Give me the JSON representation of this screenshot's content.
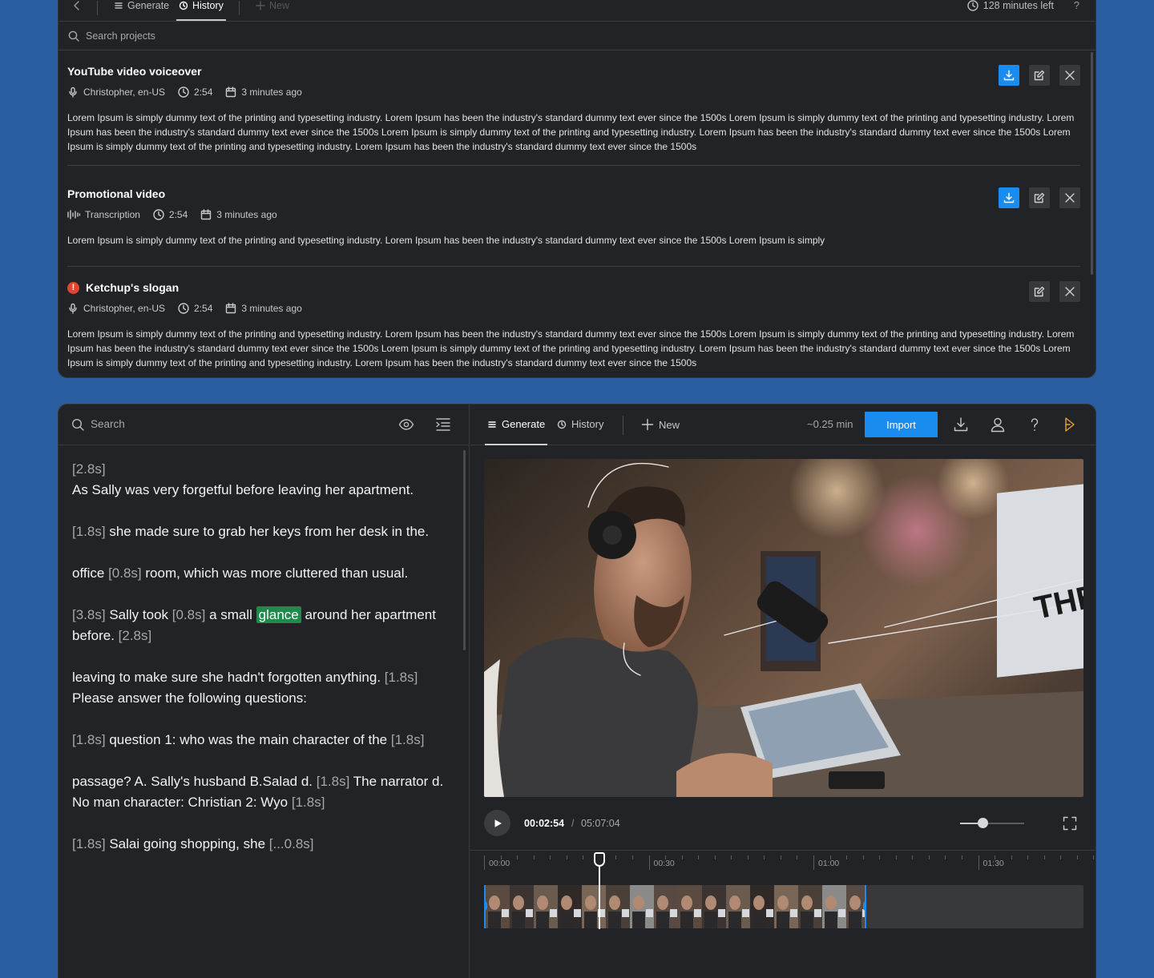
{
  "top_panel": {
    "toolbar": {
      "tabs": [
        {
          "label": "Generate"
        },
        {
          "label": "History"
        },
        {
          "label": "New"
        }
      ],
      "minutes_left": "128 minutes left",
      "help": "?"
    },
    "search": {
      "placeholder": "Search projects"
    },
    "projects": [
      {
        "title": "YouTube video voiceover",
        "voice": "Christopher, en-US",
        "duration": "2:54",
        "date": "3 minutes ago",
        "text": "Lorem Ipsum is simply dummy text of the printing and typesetting industry. Lorem Ipsum has been the industry's standard dummy text ever since the 1500s Lorem Ipsum is simply dummy text of the printing and typesetting industry. Lorem Ipsum has been the industry's standard dummy text ever since the 1500s  Lorem Ipsum is simply dummy text of the printing and typesetting industry. Lorem Ipsum has been the industry's standard dummy text ever since the 1500s Lorem Ipsum is simply dummy text of the printing and typesetting industry. Lorem Ipsum has been the industry's standard dummy text ever since the 1500s"
      },
      {
        "title": "Promotional video",
        "voice": "Transcription",
        "duration": "2:54",
        "date": "3 minutes ago",
        "text": "Lorem Ipsum is simply dummy text of the printing and typesetting industry. Lorem Ipsum has been the industry's standard dummy text ever since the 1500s Lorem Ipsum is simply"
      },
      {
        "title": "Ketchup's slogan",
        "status": "error",
        "voice": "Christopher, en-US",
        "duration": "2:54",
        "date": "3 minutes ago",
        "text": "Lorem Ipsum is simply dummy text of the printing and typesetting industry. Lorem Ipsum has been the industry's standard dummy text ever since the 1500s Lorem Ipsum is simply dummy text of the printing and typesetting industry. Lorem Ipsum has been the industry's standard dummy text ever since the 1500s  Lorem Ipsum is simply dummy text of the printing and typesetting industry. Lorem Ipsum has been the industry's standard dummy text ever since the 1500s Lorem Ipsum is simply dummy text of the printing and typesetting industry. Lorem Ipsum has been the industry's standard dummy text ever since the 1500s"
      }
    ]
  },
  "editor": {
    "search": {
      "placeholder": "Search"
    },
    "transcript": [
      {
        "t1": "[2.8s]",
        "a": "",
        "t2": "",
        "b": "",
        "br": "As Sally was very forgetful before leaving her apartment."
      },
      {
        "t1": "[1.8s]",
        "a": " she made sure to grab her keys from her desk in the."
      },
      {
        "a0": "office ",
        "t1": "[0.8s]",
        "a": " room, which was more cluttered  than usual."
      },
      {
        "t1": "[3.8s]",
        "a": " Sally took ",
        "t2": "[0.8s]",
        "b": " a small ",
        "hl": "glance",
        "c": " around her apartment before. ",
        "t3": "[2.8s]"
      },
      {
        "a0": "leaving to make sure she hadn't forgotten anything. ",
        "t1": "[1.8s]",
        "br": "Please answer the following questions:"
      },
      {
        "t1": "[1.8s]",
        "a": " question 1: who was the main character of the ",
        "t2": "[1.8s]"
      },
      {
        "a0": "passage? A. Sally's husband  B.Salad d. ",
        "t1": "[1.8s]",
        "a": " The narrator  d. No man character: Christian 2: Wyo ",
        "t2": "[1.8s]"
      },
      {
        "t1": "[1.8s]",
        "a": " Salai going shopping, she ",
        "t2": "[...0.8s]"
      }
    ],
    "toolbar": {
      "tabs": [
        {
          "label": "Generate"
        },
        {
          "label": "History"
        },
        {
          "label": "New"
        }
      ],
      "duration": "~0.25 min",
      "import_label": "Import"
    },
    "player": {
      "current": "00:02:54",
      "separator": "/",
      "total": "05:07:04",
      "volume": 0.35
    },
    "timeline": {
      "ticks": [
        "00:00",
        "00:30",
        "01:00",
        "01:30"
      ],
      "playhead_time": "00:02:54"
    }
  }
}
